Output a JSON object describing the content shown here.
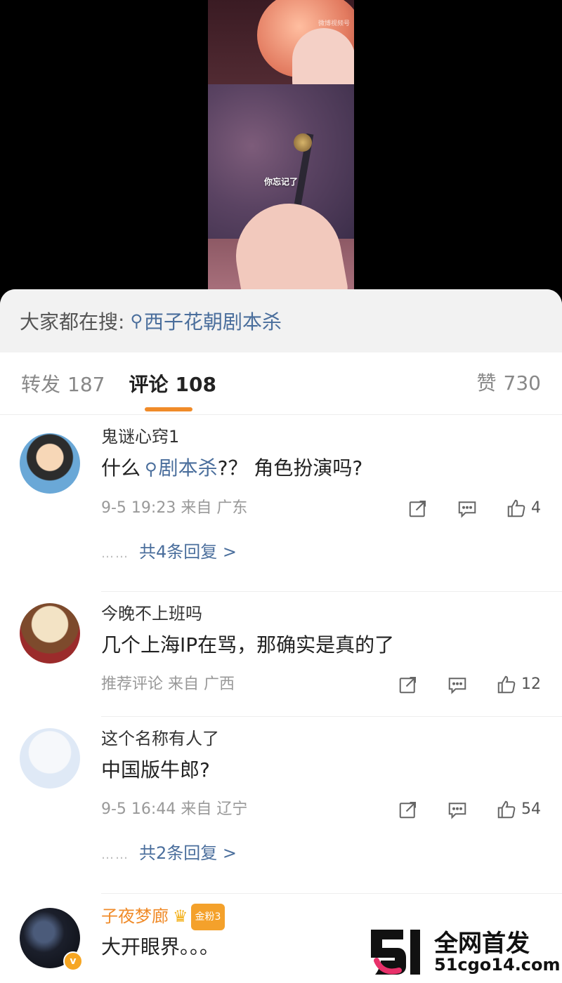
{
  "video": {
    "caption": "你忘记了",
    "watermark": "微博视频号"
  },
  "search": {
    "prefix": "大家都在搜:",
    "keyword": "西子花朝剧本杀"
  },
  "tabs": {
    "repost": {
      "label": "转发",
      "count": "187"
    },
    "comment": {
      "label": "评论",
      "count": "108"
    },
    "like": {
      "label": "赞",
      "count": "730"
    }
  },
  "comments": [
    {
      "username": "鬼谜心窍1",
      "text_before": "什么",
      "keyword": "剧本杀",
      "text_after": "?？ 角色扮演吗?",
      "meta": "9-5 19:23  来自 广东",
      "likes": "4",
      "replies_dots": "……",
      "replies": "共4条回复 >"
    },
    {
      "username": "今晚不上班吗",
      "text": "几个上海IP在骂，那确实是真的了",
      "meta": "推荐评论  来自 广西",
      "likes": "12"
    },
    {
      "username": "这个名称有人了",
      "text": "中国版牛郎?",
      "meta": "9-5 16:44  来自 辽宁",
      "likes": "54",
      "replies_dots": "……",
      "replies": "共2条回复 >"
    },
    {
      "username": "子夜梦廊",
      "badge": "金粉3",
      "avatar_badge": "v",
      "text": "大开眼界。。。"
    }
  ],
  "footer": {
    "title": "全网首发",
    "url": "51cgo14.com"
  },
  "colors": {
    "accent": "#f08b29",
    "link": "#4a6e9c",
    "meta": "#999999"
  }
}
